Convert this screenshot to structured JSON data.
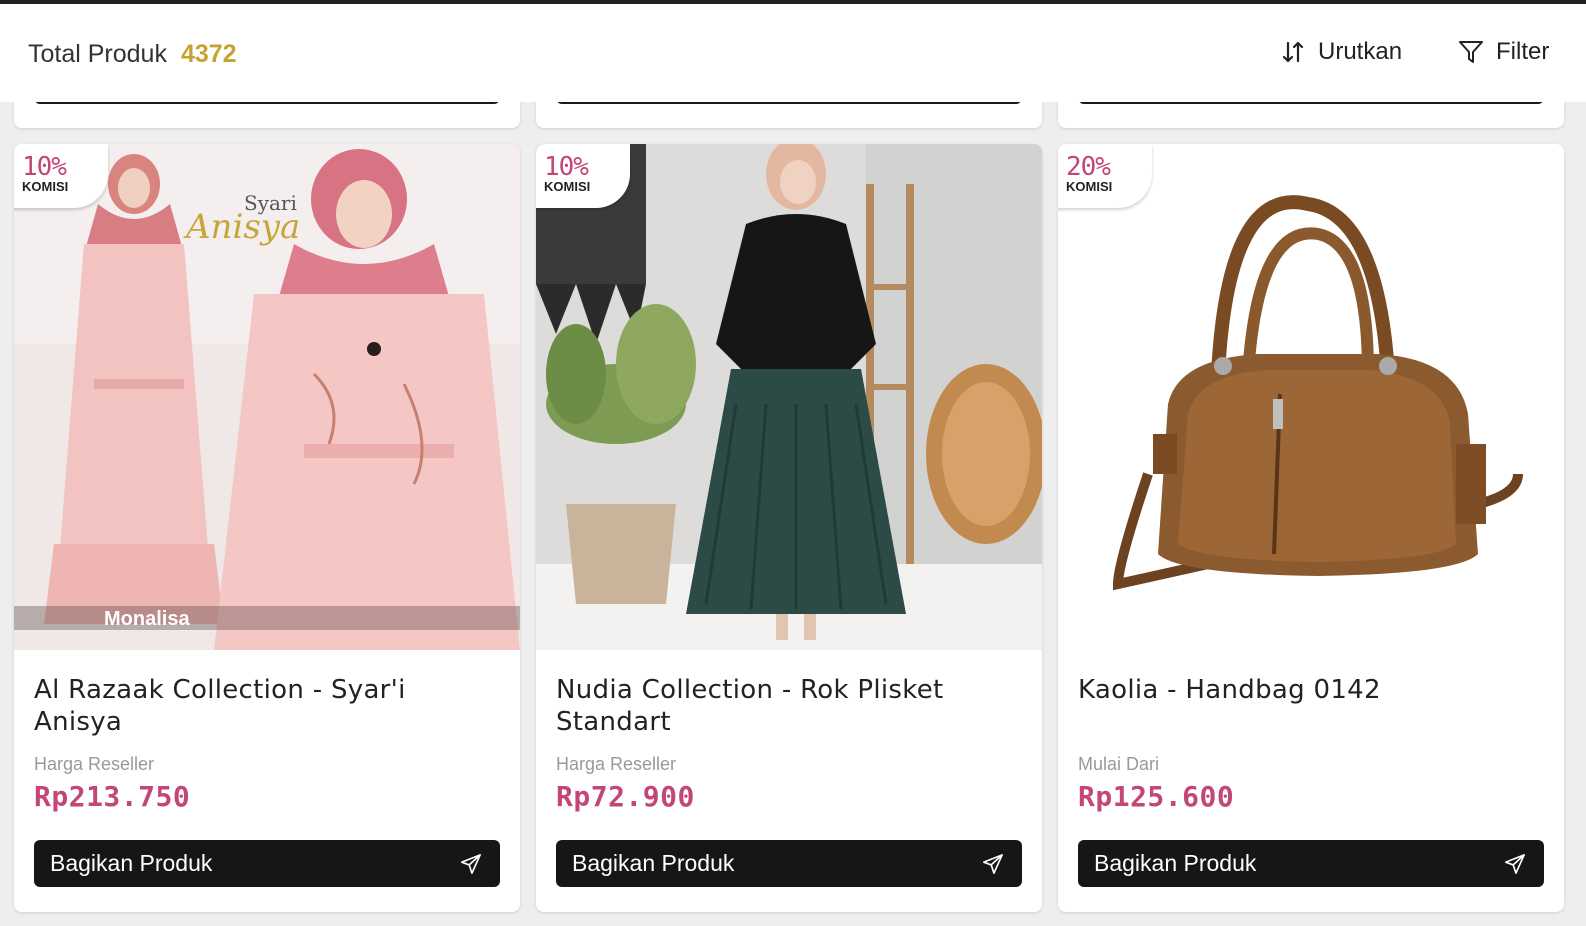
{
  "header": {
    "total_label": "Total Produk",
    "total_count": "4372",
    "sort_label": "Urutkan",
    "filter_label": "Filter"
  },
  "colors": {
    "accent_price": "#c24677",
    "count": "#c6a331",
    "button": "#161616"
  },
  "products": [
    {
      "commission": "10%",
      "commission_label": "KOMISI",
      "title": "Al Razaak Collection - Syar'i Anisya",
      "price_label": "Harga Reseller",
      "price": "Rp213.750",
      "share_label": "Bagikan Produk",
      "image_text": "Monalisa",
      "image_brand_small": "Syari",
      "image_brand": "Anisya"
    },
    {
      "commission": "10%",
      "commission_label": "KOMISI",
      "title": "Nudia Collection - Rok Plisket Standart",
      "price_label": "Harga Reseller",
      "price": "Rp72.900",
      "share_label": "Bagikan Produk"
    },
    {
      "commission": "20%",
      "commission_label": "KOMISI",
      "title": "Kaolia - Handbag 0142",
      "price_label": "Mulai Dari",
      "price": "Rp125.600",
      "share_label": "Bagikan Produk"
    }
  ]
}
